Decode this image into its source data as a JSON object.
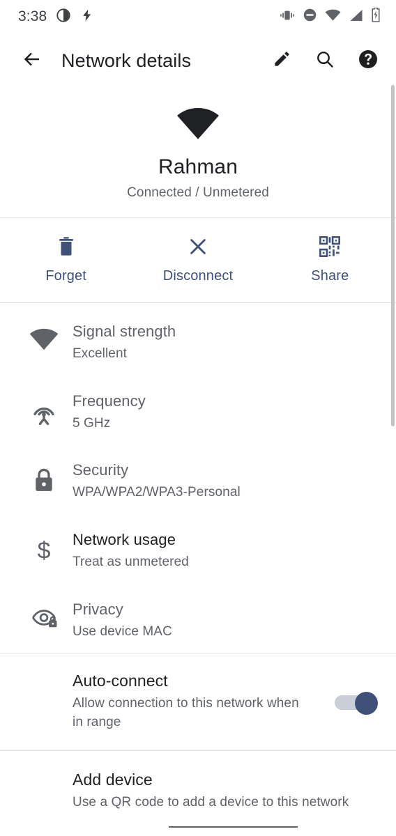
{
  "statusbar": {
    "time": "3:38",
    "left_icons": [
      "contrast-circle-icon",
      "flash-icon"
    ],
    "right_icons": [
      "vibrate-icon",
      "do-not-disturb-icon",
      "wifi-icon",
      "cellular-signal-icon",
      "battery-charging-icon"
    ]
  },
  "appbar": {
    "back_icon": "arrow-back-icon",
    "title": "Network details",
    "actions": [
      {
        "icon": "edit-pencil-icon",
        "name": "edit-button"
      },
      {
        "icon": "search-icon",
        "name": "search-button"
      },
      {
        "icon": "help-icon",
        "name": "help-button"
      }
    ]
  },
  "hero": {
    "icon": "wifi-signal-icon",
    "ssid": "Rahman",
    "status": "Connected / Unmetered"
  },
  "actions": [
    {
      "icon": "trash-icon",
      "label": "Forget"
    },
    {
      "icon": "close-x-icon",
      "label": "Disconnect"
    },
    {
      "icon": "qr-code-icon",
      "label": "Share"
    }
  ],
  "details": [
    {
      "icon": "wifi-signal-icon",
      "title": "Signal strength",
      "value": "Excellent",
      "emphasis": false
    },
    {
      "icon": "antenna-broadcast-icon",
      "title": "Frequency",
      "value": "5 GHz",
      "emphasis": false
    },
    {
      "icon": "lock-icon",
      "title": "Security",
      "value": "WPA/WPA2/WPA3-Personal",
      "emphasis": false
    },
    {
      "icon": "dollar-sign-icon",
      "title": "Network usage",
      "value": "Treat as unmetered",
      "emphasis": true
    },
    {
      "icon": "eye-privacy-icon",
      "title": "Privacy",
      "value": "Use device MAC",
      "emphasis": false
    }
  ],
  "auto_connect": {
    "title": "Auto-connect",
    "subtitle": "Allow connection to this network when in range",
    "enabled": true
  },
  "add_device": {
    "title": "Add device",
    "subtitle": "Use a QR code to add a device to this network"
  },
  "colors": {
    "accent": "#3f5178",
    "title_text": "#202124",
    "secondary_text": "#5f6368",
    "divider": "#e4e5e7",
    "icon_gray": "#5f6368",
    "background": "#ffffff",
    "toggle_track": "#c9ced8"
  }
}
